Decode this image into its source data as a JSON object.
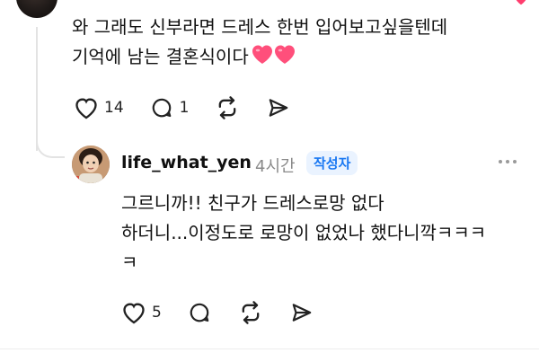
{
  "parent": {
    "text_line1": "와 그래도 신부라면 드레스 한번 입어보고싶을텐데",
    "text_line2": "기억에 남는 결혼식이다",
    "emoji": "pink-hearts",
    "likes": "14",
    "replies": "1"
  },
  "reply": {
    "username": "life_what_yen",
    "time": "4시간",
    "author_badge": "작성자",
    "text_line1": "그르니까!! 친구가 드레스로망 없다",
    "text_line2": "하더니...이정도로 로망이 없었나 했다니깍ㅋㅋㅋ",
    "text_line3": "ㅋ",
    "likes": "5"
  },
  "icons": {
    "like": "heart-outline-icon",
    "comment": "comment-bubble-icon",
    "repost": "repost-arrows-icon",
    "share": "send-icon",
    "more": "more-dots-icon"
  },
  "colors": {
    "heart_pink": "#ff3d6e",
    "badge_bg": "#eaf3ff",
    "badge_text": "#1877f2",
    "muted": "#8a8a8a",
    "thread_line": "#e3e3e3"
  }
}
